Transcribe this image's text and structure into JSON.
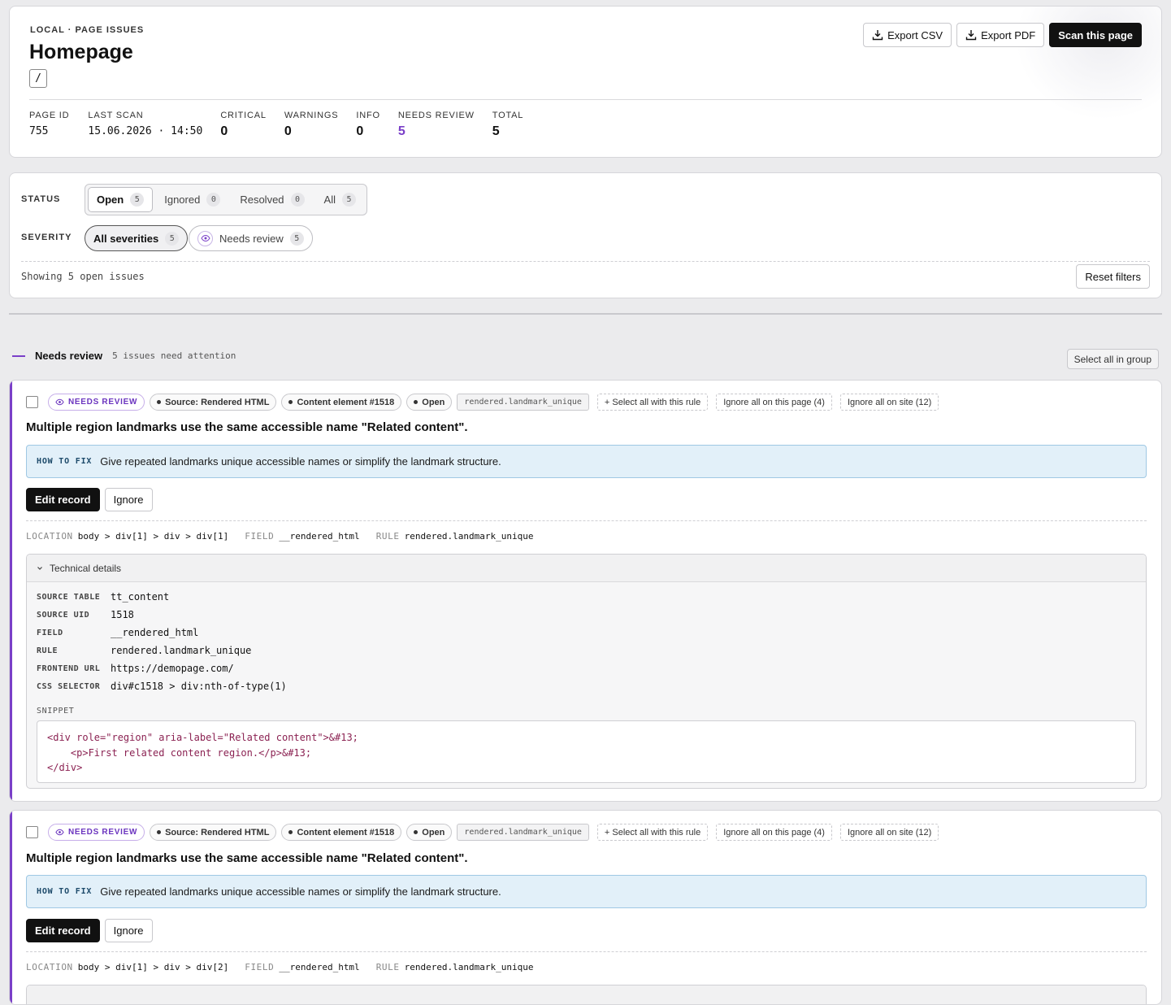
{
  "header": {
    "eyebrow": "LOCAL · PAGE ISSUES",
    "title": "Homepage",
    "slug": "/",
    "actions": {
      "export_csv": "Export CSV",
      "export_pdf": "Export PDF",
      "scan": "Scan this page"
    },
    "stats": [
      {
        "label": "PAGE ID",
        "value": "755"
      },
      {
        "label": "LAST SCAN",
        "value": "15.06.2026 · 14:50"
      },
      {
        "label": "CRITICAL",
        "value": "0"
      },
      {
        "label": "WARNINGS",
        "value": "0"
      },
      {
        "label": "INFO",
        "value": "0"
      },
      {
        "label": "NEEDS REVIEW",
        "value": "5"
      },
      {
        "label": "TOTAL",
        "value": "5"
      }
    ]
  },
  "filters": {
    "status_label": "STATUS",
    "status_tabs": [
      {
        "label": "Open",
        "count": "5"
      },
      {
        "label": "Ignored",
        "count": "0"
      },
      {
        "label": "Resolved",
        "count": "0"
      },
      {
        "label": "All",
        "count": "5"
      }
    ],
    "severity_label": "SEVERITY",
    "severity_pills": [
      {
        "label": "All severities",
        "count": "5"
      },
      {
        "label": "Needs review",
        "count": "5"
      }
    ],
    "showing": "Showing 5 open issues",
    "reset": "Reset filters"
  },
  "group": {
    "title": "Needs review",
    "subtitle": "5 issues need attention",
    "select_all": "Select all in group"
  },
  "issues": [
    {
      "severity_tag": "NEEDS REVIEW",
      "source_tag": "Source: Rendered HTML",
      "element_tag": "Content element #1518",
      "status_tag": "Open",
      "rule_tag": "rendered.landmark_unique",
      "action_select_rule": "+ Select all with this rule",
      "action_ignore_page": "Ignore all on this page (4)",
      "action_ignore_site": "Ignore all on site (12)",
      "title": "Multiple region landmarks use the same accessible name \"Related content\".",
      "howto_label": "HOW TO FIX",
      "howto_text": "Give repeated landmarks unique accessible names or simplify the landmark structure.",
      "edit_label": "Edit record",
      "ignore_label": "Ignore",
      "location_label": "LOCATION",
      "location": "body > div[1] > div > div[1]",
      "field_label": "FIELD",
      "field": "__rendered_html",
      "rule_label": "RULE",
      "rule": "rendered.landmark_unique",
      "tech_title": "Technical details",
      "tech_rows": [
        {
          "k": "SOURCE TABLE",
          "v": "tt_content"
        },
        {
          "k": "SOURCE UID",
          "v": "1518"
        },
        {
          "k": "FIELD",
          "v": "__rendered_html"
        },
        {
          "k": "RULE",
          "v": "rendered.landmark_unique"
        },
        {
          "k": "FRONTEND URL",
          "v": "https://demopage.com/"
        },
        {
          "k": "CSS SELECTOR",
          "v": "div#c1518 > div:nth-of-type(1)"
        }
      ],
      "snippet_label": "SNIPPET",
      "snippet": "<div role=\"region\" aria-label=\"Related content\">&#13;\n    <p>First related content region.</p>&#13;\n</div>"
    },
    {
      "severity_tag": "NEEDS REVIEW",
      "source_tag": "Source: Rendered HTML",
      "element_tag": "Content element #1518",
      "status_tag": "Open",
      "rule_tag": "rendered.landmark_unique",
      "action_select_rule": "+ Select all with this rule",
      "action_ignore_page": "Ignore all on this page (4)",
      "action_ignore_site": "Ignore all on site (12)",
      "title": "Multiple region landmarks use the same accessible name \"Related content\".",
      "howto_label": "HOW TO FIX",
      "howto_text": "Give repeated landmarks unique accessible names or simplify the landmark structure.",
      "edit_label": "Edit record",
      "ignore_label": "Ignore",
      "location_label": "LOCATION",
      "location": "body > div[1] > div > div[2]",
      "field_label": "FIELD",
      "field": "__rendered_html",
      "rule_label": "RULE",
      "rule": "rendered.landmark_unique"
    }
  ]
}
